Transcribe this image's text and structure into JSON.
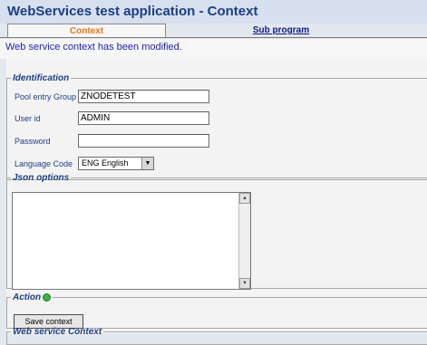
{
  "header": {
    "title": "WebServices test application - Context"
  },
  "tabs": [
    {
      "label": "Context"
    },
    {
      "label": "Sub program"
    }
  ],
  "status": {
    "message": "Web service context has been modified."
  },
  "identification": {
    "legend": "Identification",
    "pool_entry_group": {
      "label": "Pool entry Group",
      "value": "ZNODETEST"
    },
    "user_id": {
      "label": "User id",
      "value": "ADMIN"
    },
    "password": {
      "label": "Password",
      "value": ""
    },
    "language_code": {
      "label": "Language Code",
      "selected": "ENG English"
    }
  },
  "json_options": {
    "legend": "Json options",
    "value": ""
  },
  "action": {
    "legend": "Action",
    "save_button": "Save context"
  },
  "web_service_context": {
    "legend": "Web service Context"
  },
  "colors": {
    "title_text": "#1d3f86",
    "active_tab_text": "#e8761c",
    "message_text": "#1f1fb4"
  }
}
